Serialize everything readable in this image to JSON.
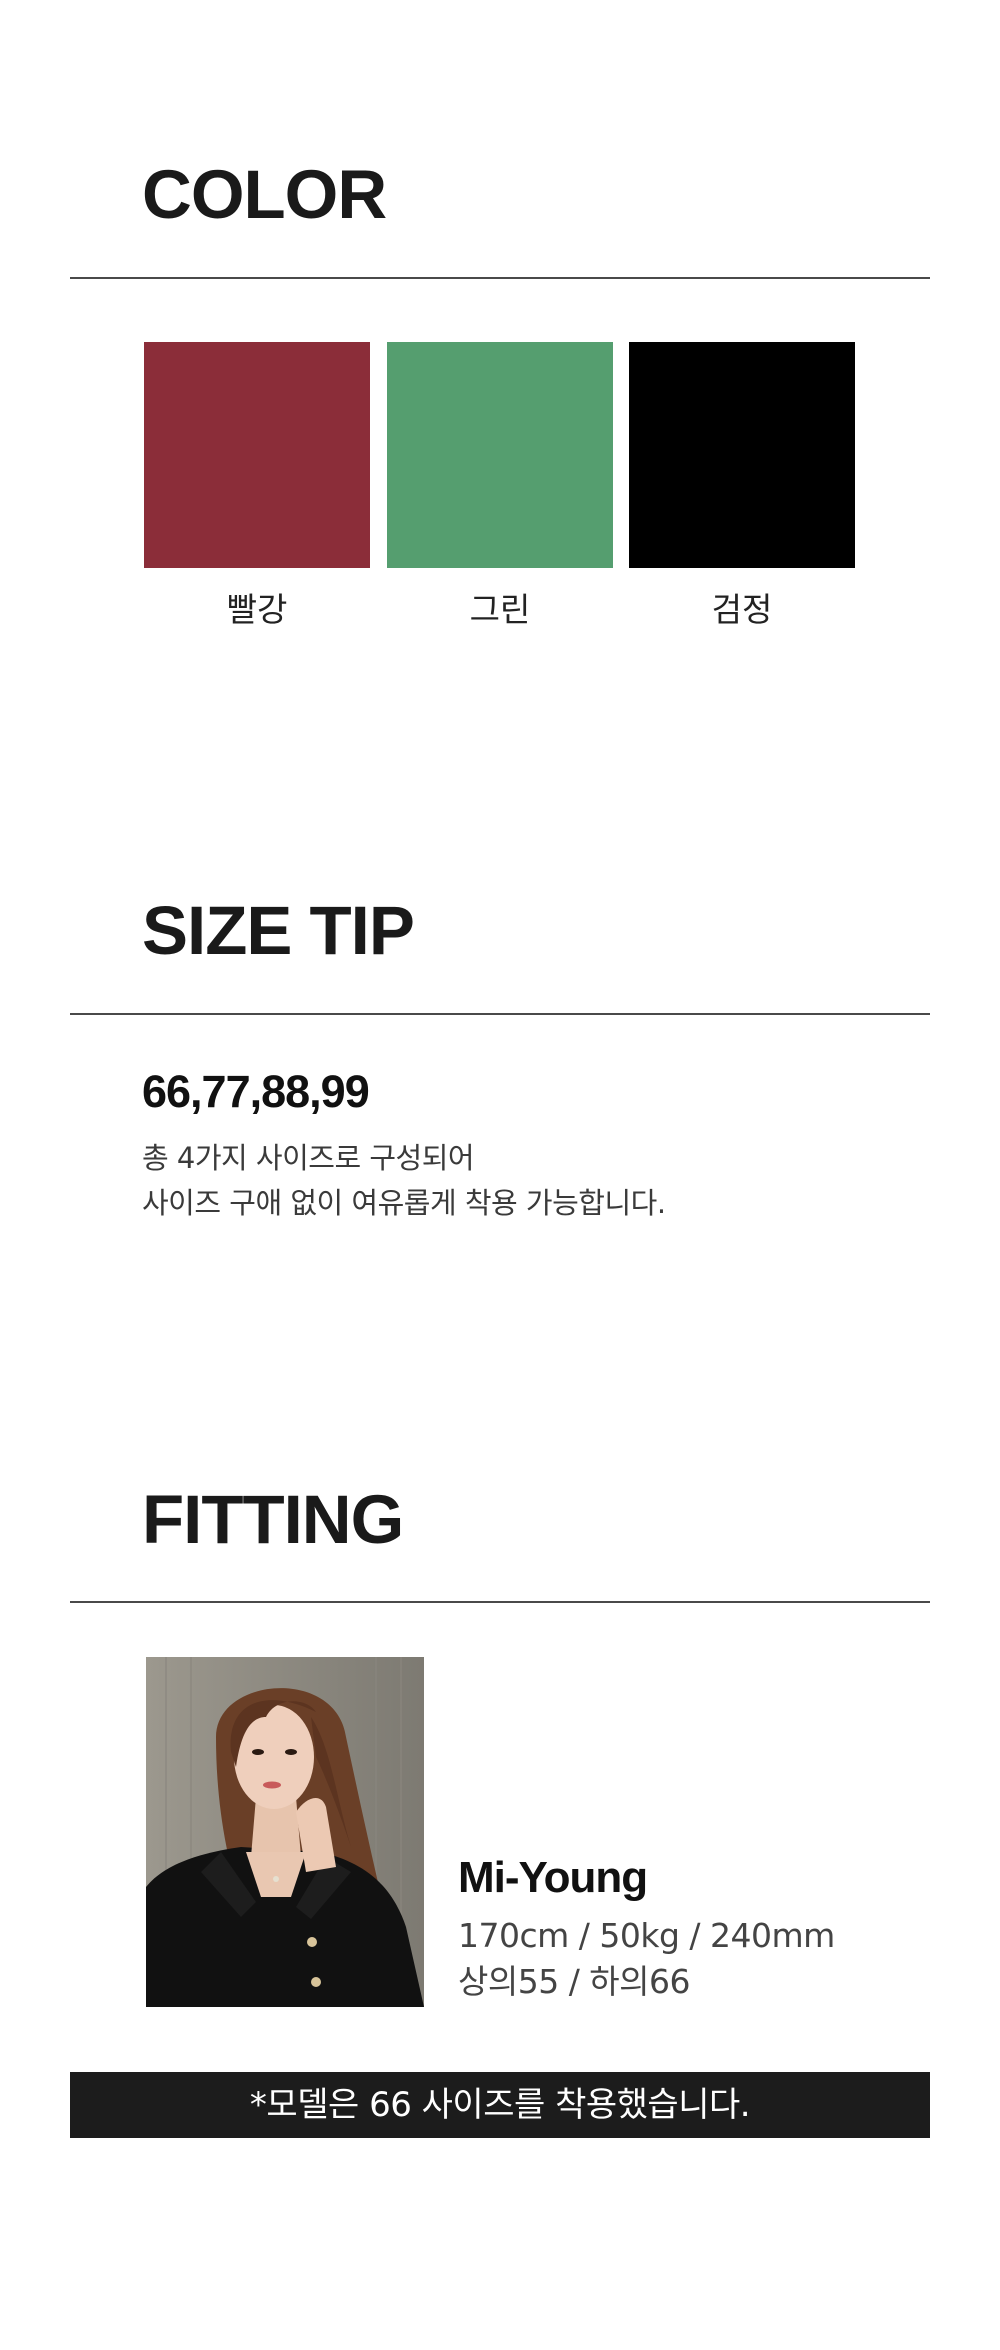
{
  "color_section": {
    "title": "COLOR",
    "swatches": [
      {
        "label": "빨강",
        "color": "#8b2d39"
      },
      {
        "label": "그린",
        "color": "#559e6f"
      },
      {
        "label": "검정",
        "color": "#000000"
      }
    ]
  },
  "size_section": {
    "title": "SIZE TIP",
    "sizes": "66,77,88,99",
    "description_line1": "총 4가지 사이즈로 구성되어",
    "description_line2": "사이즈 구애 없이 여유롭게 착용 가능합니다."
  },
  "fitting_section": {
    "title": "FITTING",
    "model_name": "Mi-Young",
    "model_measurements": "170cm / 50kg / 240mm",
    "model_sizes": "상의55 / 하의66",
    "notice": "*모델은 66 사이즈를 착용했습니다."
  }
}
